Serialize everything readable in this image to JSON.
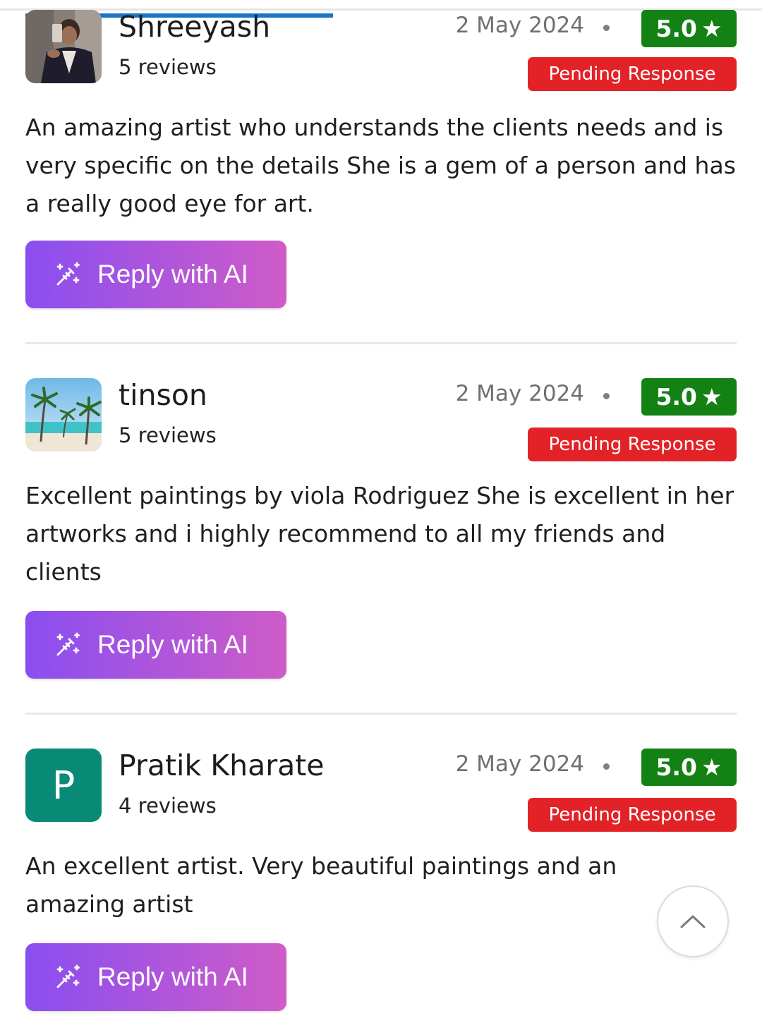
{
  "reviews": [
    {
      "name": "Shreeyash",
      "review_count": "5 reviews",
      "date": "2 May 2024",
      "rating": "5.0",
      "status": "Pending Response",
      "text": "An amazing artist who understands the clients needs and is very specific on the details She is a gem of a person and has a really good eye for art.",
      "avatar": "photo-person-selfie",
      "button_label": "Reply with AI"
    },
    {
      "name": "tinson",
      "review_count": "5 reviews",
      "date": "2 May 2024",
      "rating": "5.0",
      "status": "Pending Response",
      "text": "Excellent paintings by viola Rodriguez She is excellent in her artworks and i highly recommend to all my friends and clients",
      "avatar": "photo-beach-palms",
      "button_label": "Reply with AI"
    },
    {
      "name": "Pratik Kharate",
      "review_count": "4 reviews",
      "date": "2 May 2024",
      "rating": "5.0",
      "status": "Pending Response",
      "text": "An excellent artist. Very beautiful paintings and an amazing artist",
      "avatar_initial": "P",
      "button_label": "Reply with AI"
    }
  ],
  "colors": {
    "rating_badge": "#138113",
    "pending_badge": "#e32227",
    "button_gradient_start": "#8a4ef0",
    "button_gradient_end": "#cf5cc8",
    "initial_avatar": "#098a77",
    "progress": "#1a73c7"
  },
  "icons": {
    "button_icon": "magic-wand-sparkle-icon",
    "rating_icon": "star-icon",
    "scroll_top_icon": "chevron-up-icon"
  }
}
